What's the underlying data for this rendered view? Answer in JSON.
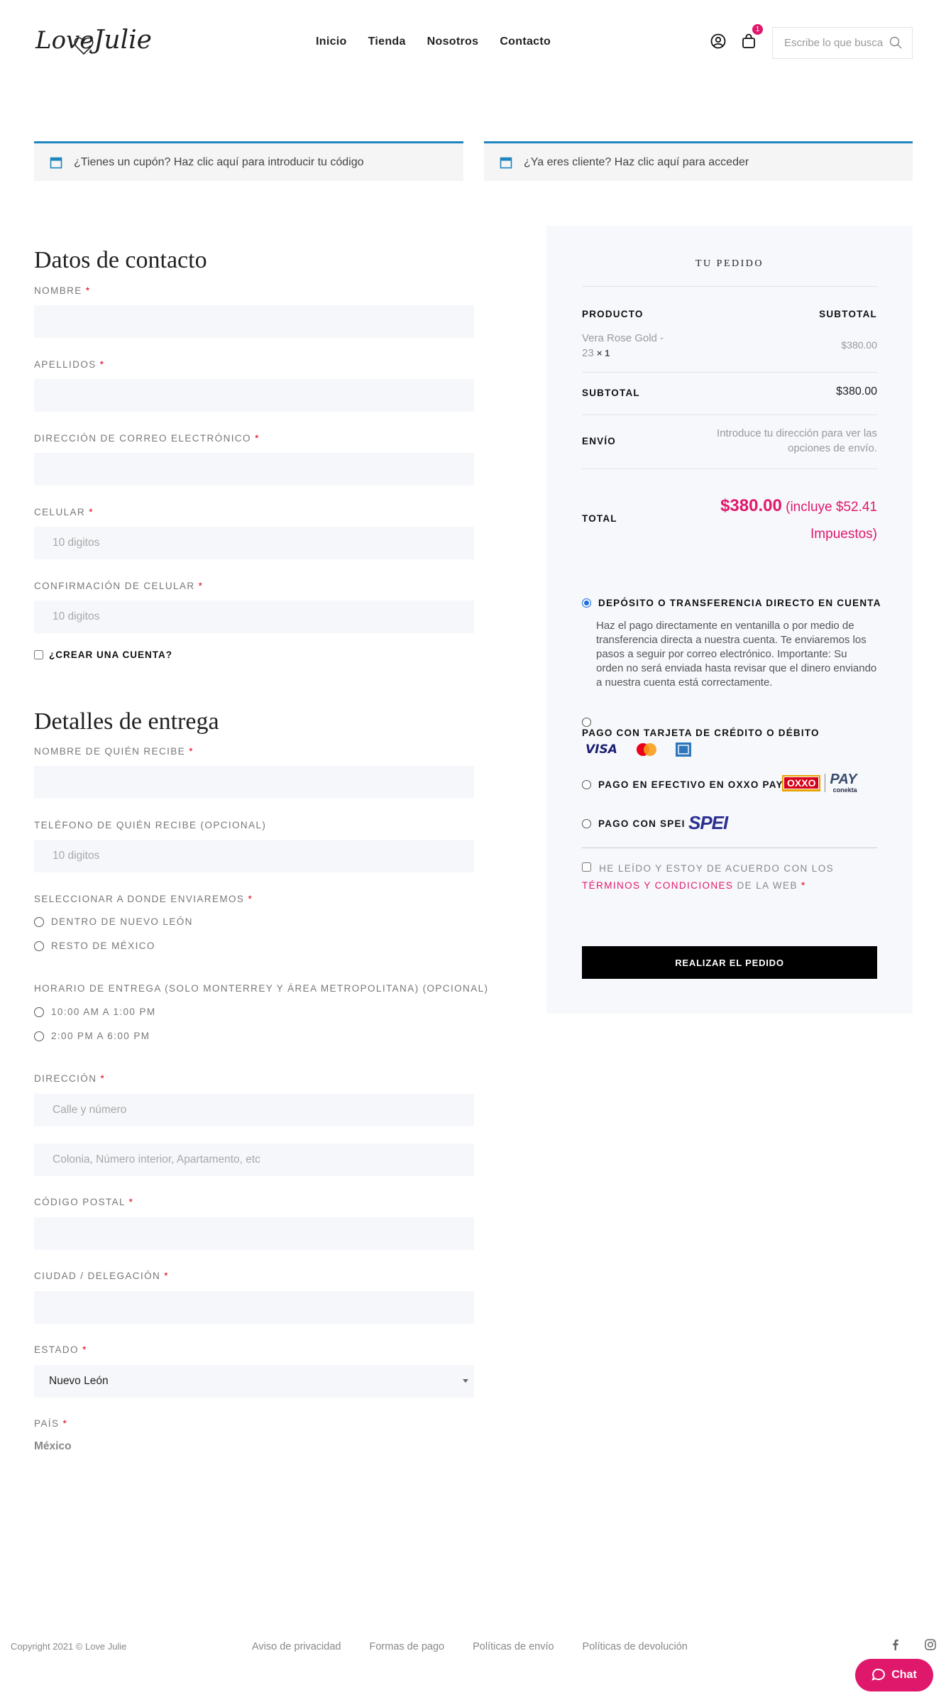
{
  "brand": {
    "logo_text": "Love Julie",
    "accent": "#e0186c",
    "link_blue": "#1e85be"
  },
  "nav": {
    "items": [
      "Inicio",
      "Tienda",
      "Nosotros",
      "Contacto"
    ]
  },
  "header": {
    "cart_count": "1",
    "search_placeholder": "Escribe lo que busca"
  },
  "notices": {
    "coupon": "¿Tienes un cupón? Haz clic aquí para introducir tu código",
    "login": "¿Ya eres cliente? Haz clic aquí para acceder"
  },
  "contact": {
    "title": "Datos de contacto",
    "nombre": "NOMBRE",
    "apellidos": "APELLIDOS",
    "email": "DIRECCIÓN DE CORREO ELECTRÓNICO",
    "celular": "CELULAR",
    "celular_placeholder": "10 digitos",
    "confirm": "CONFIRMACIÓN DE CELULAR",
    "confirm_placeholder": "10 digitos",
    "create_account": "¿CREAR UNA CUENTA?"
  },
  "delivery": {
    "title": "Detalles de entrega",
    "receiver_name": "NOMBRE DE QUIÉN RECIBE",
    "receiver_phone": "TELÉFONO DE QUIÉN RECIBE (OPCIONAL)",
    "receiver_phone_placeholder": "10 digitos",
    "zone_label": "SELECCIONAR A DONDE ENVIAREMOS",
    "zone_options": [
      "DENTRO DE NUEVO LEÓN",
      "RESTO DE MÉXICO"
    ],
    "schedule_label": "HORARIO DE ENTREGA (SOLO MONTERREY Y ÁREA METROPOLITANA) (OPCIONAL)",
    "schedule_options": [
      "10:00 AM A 1:00 PM",
      "2:00 PM A 6:00 PM"
    ],
    "address_label": "DIRECCIÓN",
    "address1_placeholder": "Calle y número",
    "address2_placeholder": "Colonia, Número interior, Apartamento, etc",
    "zip": "CÓDIGO POSTAL",
    "city": "CIUDAD / DELEGACIÓN",
    "state_label": "ESTADO",
    "state_value": "Nuevo León",
    "country_label": "PAÍS",
    "country_value": "México"
  },
  "order": {
    "title": "TU PEDIDO",
    "col_product": "PRODUCTO",
    "col_subtotal": "SUBTOTAL",
    "item_name": "Vera Rose Gold - 23",
    "item_qty": "× 1",
    "item_price": "$380.00",
    "subtotal_label": "SUBTOTAL",
    "subtotal_value": "$380.00",
    "shipping_label": "ENVÍO",
    "shipping_value": "Introduce tu dirección para ver las opciones de envío.",
    "total_label": "TOTAL",
    "total_value": "$380.00",
    "total_tax": "(incluye $52.41 Impuestos)",
    "pay_transfer": "DEPÓSITO O TRANSFERENCIA DIRECTO EN CUENTA",
    "pay_transfer_desc": "Haz el pago directamente en ventanilla o por medio de transferencia directa a nuestra cuenta. Te enviaremos los pasos a seguir por correo electrónico. Importante: Su orden no será enviada hasta revisar que el dinero enviando a nuestra cuenta está correctamente.",
    "pay_card": "PAGO CON TARJETA DE CRÉDITO O DÉBITO",
    "pay_oxxo": "PAGO EN EFECTIVO EN OXXO PAY",
    "pay_spei": "PAGO CON SPEI",
    "logo_visa": "VISA",
    "logo_oxxo": "OXXO",
    "logo_pay": "PAY",
    "logo_conekta": "conekta",
    "logo_spei": "SPEI",
    "terms_pre": "HE LEÍDO Y ESTOY DE ACUERDO CON LOS",
    "terms_link": "TÉRMINOS Y CONDICIONES",
    "terms_post": "DE LA WEB",
    "place_order": "REALIZAR EL PEDIDO"
  },
  "footer": {
    "copyright": "Copyright 2021 © Love Julie",
    "links": [
      "Aviso de privacidad",
      "Formas de pago",
      "Políticas de envío",
      "Políticas de devolución"
    ],
    "chat": "Chat"
  }
}
